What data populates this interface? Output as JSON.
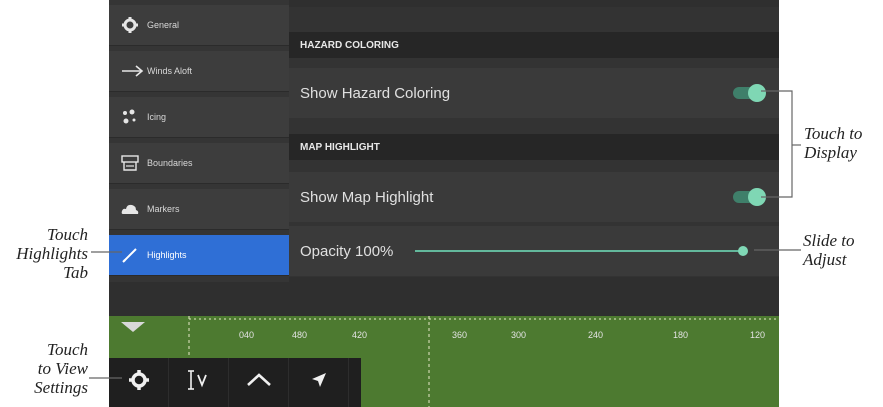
{
  "sidebar": {
    "items": [
      {
        "label": "General",
        "icon": "gear-icon"
      },
      {
        "label": "Winds Aloft",
        "icon": "arrow-right-icon"
      },
      {
        "label": "Icing",
        "icon": "icing-icon"
      },
      {
        "label": "Boundaries",
        "icon": "boundaries-icon"
      },
      {
        "label": "Markers",
        "icon": "cloud-icon"
      },
      {
        "label": "Highlights",
        "icon": "pencil-icon",
        "active": true
      }
    ]
  },
  "panel": {
    "hazard_header": "HAZARD COLORING",
    "hazard_row": {
      "label": "Show Hazard Coloring",
      "enabled": true
    },
    "map_header": "MAP HIGHLIGHT",
    "map_row": {
      "label": "Show Map Highlight",
      "enabled": true
    },
    "opacity": {
      "label": "Opacity 100%",
      "value": 100
    }
  },
  "map": {
    "ticks": [
      "040",
      "480",
      "420",
      "360",
      "300",
      "240",
      "180",
      "120"
    ]
  },
  "toolbar": {
    "buttons": [
      "settings-gear-icon",
      "altitude-icon",
      "profile-icon",
      "navigate-icon"
    ]
  },
  "callouts": {
    "display": [
      "Touch to",
      "Display"
    ],
    "slide": [
      "Slide to",
      "Adjust"
    ],
    "highlights": [
      "Touch",
      "Highlights",
      "Tab"
    ],
    "settings": [
      "Touch",
      "to View",
      "Settings"
    ]
  },
  "colors": {
    "accent_active": "#2f6fd6",
    "toggle_on": "#7fd7b4",
    "map_green": "#4d7a30"
  }
}
